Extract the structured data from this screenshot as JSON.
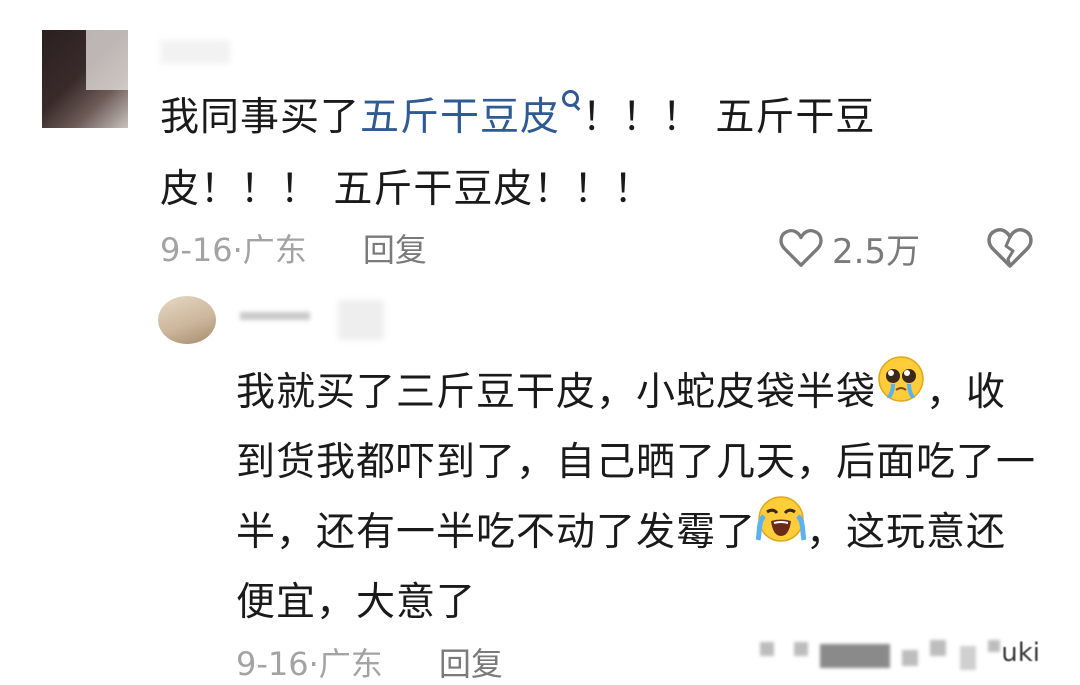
{
  "comment": {
    "text_prefix": "我同事买了",
    "link_text": "五斤干豆皮",
    "text_suffix": "！！！ 五斤干豆皮！！！ 五斤干豆皮！！！",
    "date": "9-16",
    "location": "广东",
    "reply_label": "回复",
    "like_count": "2.5万",
    "like_icon": "heart-outline-icon",
    "dislike_icon": "broken-heart-icon"
  },
  "reply": {
    "text_part1": "我就买了三斤豆干皮，小蛇皮袋半袋",
    "emoji1": "pleading-face-emoji",
    "text_part2": "，收到货我都吓到了，自己晒了几天，后面吃了一半，还有一半吃不动了发霉了",
    "emoji2": "loudly-crying-face-emoji",
    "text_part3": "，这玩意还便宜，大意了",
    "date": "9-16",
    "location": "广东",
    "reply_label": "回复"
  },
  "watermark": {
    "visible_text": "uki"
  },
  "colors": {
    "link": "#2f5a93",
    "meta": "#a3a3a3",
    "icon": "#7a7a7a"
  }
}
